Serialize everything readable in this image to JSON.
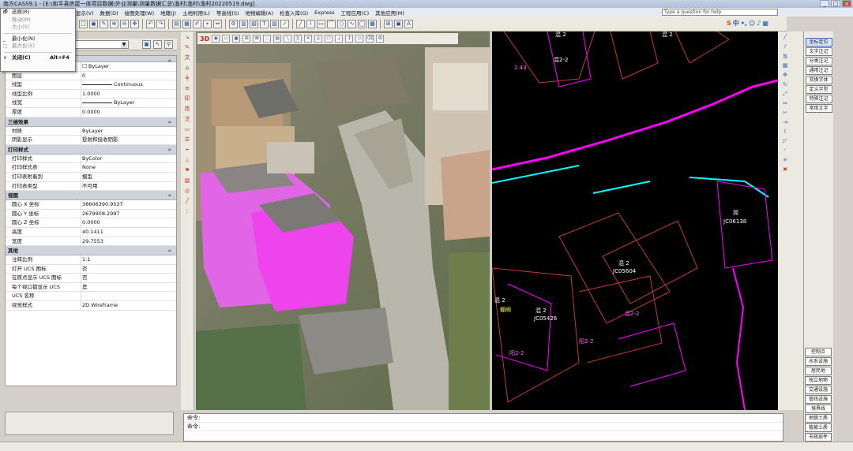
{
  "window": {
    "title": "南方CASS9.1 - [E:\\和平县房屋一体项目数据\\外业测量\\测量数据汇总\\渔村\\渔村\\渔村20220519.dwg]",
    "buttons": [
      "_",
      "□",
      "×"
    ],
    "help_placeholder": "Type a question for help"
  },
  "menubar": [
    "显示(V)",
    "数据(D)",
    "绘图处理(W)",
    "地籍(J)",
    "土地利用(L)",
    "等高线(S)",
    "地物编辑(A)",
    "检查入库(G)",
    "Express",
    "工程应用(C)",
    "其他应用(M)"
  ],
  "system_menu": {
    "items": [
      {
        "glyph": "🗗",
        "label": "还原(R)",
        "accel": "",
        "disabled": false
      },
      {
        "glyph": "",
        "label": "移动(M)",
        "accel": "",
        "disabled": true
      },
      {
        "glyph": "",
        "label": "大小(S)",
        "accel": "",
        "disabled": true
      },
      {
        "glyph": "_",
        "label": "最小化(N)",
        "accel": "",
        "disabled": false
      },
      {
        "glyph": "□",
        "label": "最大化(X)",
        "accel": "",
        "disabled": true
      },
      {
        "glyph": "×",
        "label": "关闭(C)",
        "accel": "Alt+F4",
        "disabled": false,
        "bold": true
      }
    ]
  },
  "layer": {
    "value": "0"
  },
  "properties": {
    "general_rows": [
      {
        "key": "颜色",
        "value": "ByLayer",
        "swatch": true
      },
      {
        "key": "图层",
        "value": "0"
      },
      {
        "key": "线型",
        "value": "Continuous",
        "line": true
      },
      {
        "key": "线型比例",
        "value": "1.0000"
      },
      {
        "key": "线宽",
        "value": "ByLayer",
        "line": true
      },
      {
        "key": "厚度",
        "value": "0.0000"
      }
    ],
    "sections": [
      {
        "title": "三维效果",
        "rows": [
          {
            "key": "材质",
            "value": "ByLayer"
          },
          {
            "key": "阴影显示",
            "value": "投射和接收阴影"
          }
        ]
      },
      {
        "title": "打印样式",
        "rows": [
          {
            "key": "打印样式",
            "value": "ByColor"
          },
          {
            "key": "打印样式表",
            "value": "None"
          },
          {
            "key": "打印表附着到",
            "value": "模型"
          },
          {
            "key": "打印表类型",
            "value": "不可用"
          }
        ]
      },
      {
        "title": "视图",
        "rows": [
          {
            "key": "圆心 X 坐标",
            "value": "38606390.9537"
          },
          {
            "key": "圆心 Y 坐标",
            "value": "2679908.2997"
          },
          {
            "key": "圆心 Z 坐标",
            "value": "0.0000"
          },
          {
            "key": "高度",
            "value": "40.1411"
          },
          {
            "key": "宽度",
            "value": "29.7553"
          }
        ]
      },
      {
        "title": "其他",
        "rows": [
          {
            "key": "注释比例",
            "value": "1:1"
          },
          {
            "key": "打开 UCS 图标",
            "value": "否"
          },
          {
            "key": "在原点显示 UCS 图标",
            "value": "否"
          },
          {
            "key": "每个视口都显示 UCS",
            "value": "是"
          },
          {
            "key": "UCS 名称",
            "value": ""
          },
          {
            "key": "视觉样式",
            "value": "2D Wireframe"
          }
        ]
      }
    ]
  },
  "photo_toolbar": {
    "mode_label": "3D"
  },
  "cad_labels": {
    "top_left": "混 2",
    "top_mid": "混2-2",
    "top_num": "2.43",
    "top_right": "混 2",
    "right_bldg": "简",
    "right_code": "JC06138",
    "center_bldg": "混 2",
    "center_code": "JC05604",
    "left_bldg": "混 2",
    "left_code": "JC05426",
    "left_small": "棚阀",
    "left_edge": "混 2",
    "bottom_mid": "混2-2",
    "bottom_left": "阳2-2",
    "bottom_mid2": "阳2-2"
  },
  "right_panel": {
    "top_items": [
      "坐标定位",
      "文字注记",
      "分类注记",
      "通用注记",
      "变换字体",
      "定义字型",
      "特殊注记",
      "常用文字"
    ],
    "bottom_items": [
      "控制点",
      "水系设施",
      "居民地",
      "独立地物",
      "交通设施",
      "管线设施",
      "境界线",
      "地貌土质",
      "植被土质",
      "市政部件"
    ],
    "active": "坐标定位"
  },
  "command": {
    "lines": [
      "命令:",
      "命令:"
    ]
  },
  "colors": {
    "magenta": "#ff00ff",
    "cyan": "#00ffff",
    "red_line": "#c23a3a",
    "cad_bg": "#000000"
  }
}
